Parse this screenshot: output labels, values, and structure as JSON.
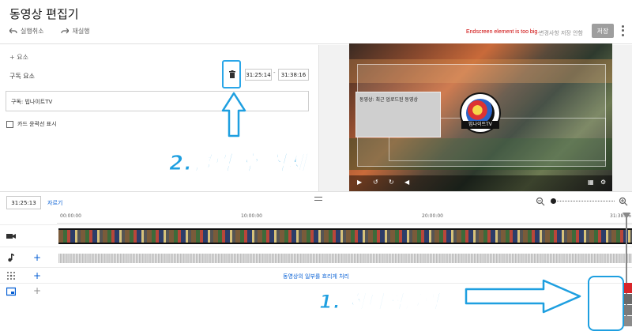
{
  "header": {
    "title": "동영상 편집기",
    "undo_label": "실행취소",
    "redo_label": "재실행",
    "error_message": "Endscreen element is too big.",
    "unsaved_label": "변경사항 저장 안함",
    "save_label": "저장"
  },
  "elements_panel": {
    "add_element_label": "+ 요소",
    "subscribe_label": "구독 요소",
    "start_time": "31:25:14",
    "separator": "-",
    "end_time": "31:38:16",
    "channel_label": "구독: 빕나이트TV",
    "card_checkbox_label": "카드 윤곽선 표시"
  },
  "preview": {
    "card_text": "동영상: 최근 업로드된 동영상",
    "logo_text": "빕나이트TV"
  },
  "annotations": {
    "step2_text": "2.클릭 후 삭제",
    "step1_text": "1. 하나씩클릭",
    "color": "#1e9fe0"
  },
  "timeline": {
    "current_time": "31:25:13",
    "trim_label": "자르기",
    "ruler": [
      "00:00:00",
      "10:00:00",
      "20:00:00",
      "31:38:16"
    ],
    "blur_notice": "동영상의 일부를 흐리게 처리"
  },
  "icons": {
    "undo": "undo-icon",
    "redo": "redo-icon",
    "trash": "trash-icon",
    "zoom_out": "zoom-out-icon",
    "zoom_in": "zoom-in-icon",
    "video_track": "video-camera-icon",
    "music_track": "music-note-icon",
    "blur_track": "blur-grid-icon",
    "endscreen_track": "endscreen-icon"
  }
}
